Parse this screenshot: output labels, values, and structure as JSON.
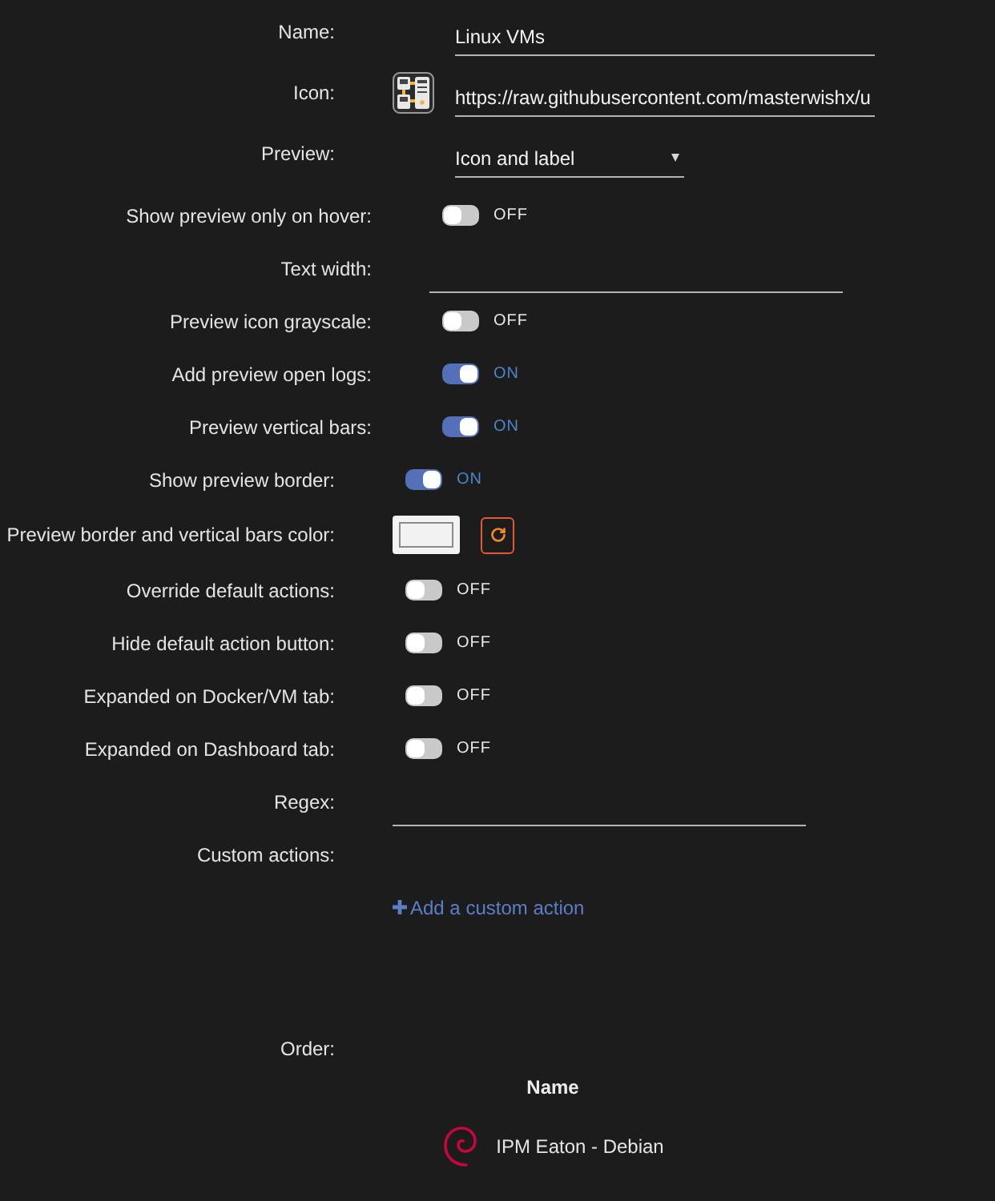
{
  "main": [
    {
      "kind": "text",
      "label": "Name:",
      "value": "Linux VMs"
    },
    {
      "kind": "icon",
      "label": "Icon:",
      "value": "https://raw.githubusercontent.com/masterwishx/u"
    },
    {
      "kind": "select",
      "label": "Preview:",
      "value": "Icon and label",
      "children": [
        {
          "kind": "toggle",
          "label": "Show preview only on hover:",
          "on": false,
          "state_label": "OFF"
        },
        {
          "kind": "text",
          "label": "Text width:"
        },
        {
          "kind": "toggle",
          "label": "Preview icon grayscale:",
          "on": false,
          "state_label": "OFF"
        },
        {
          "kind": "toggle",
          "label": "Add preview open logs:",
          "on": true,
          "state_label": "ON"
        },
        {
          "kind": "toggle",
          "label": "Preview vertical bars:",
          "on": true,
          "state_label": "ON"
        }
      ]
    }
  ],
  "options": [
    {
      "kind": "toggle",
      "label": "Show preview border:",
      "on": true,
      "state_label": "ON"
    },
    {
      "kind": "color",
      "label": "Preview border and vertical bars color:",
      "color": "#f2f2f2"
    },
    {
      "kind": "toggle",
      "label": "Override default actions:",
      "on": false,
      "state_label": "OFF"
    },
    {
      "kind": "toggle",
      "label": "Hide default action button:",
      "on": false,
      "state_label": "OFF"
    },
    {
      "kind": "toggle",
      "label": "Expanded on Docker/VM tab:",
      "on": false,
      "state_label": "OFF"
    },
    {
      "kind": "toggle",
      "label": "Expanded on Dashboard tab:",
      "on": false,
      "state_label": "OFF"
    },
    {
      "kind": "text",
      "label": "Regex:"
    }
  ],
  "custom_actions": {
    "label": "Custom actions:",
    "add_link": "Add a custom action"
  },
  "order": {
    "label": "Order:",
    "columns": [
      "Name"
    ],
    "rows": [
      {
        "name": "IPM Eaton - Debian"
      }
    ]
  }
}
